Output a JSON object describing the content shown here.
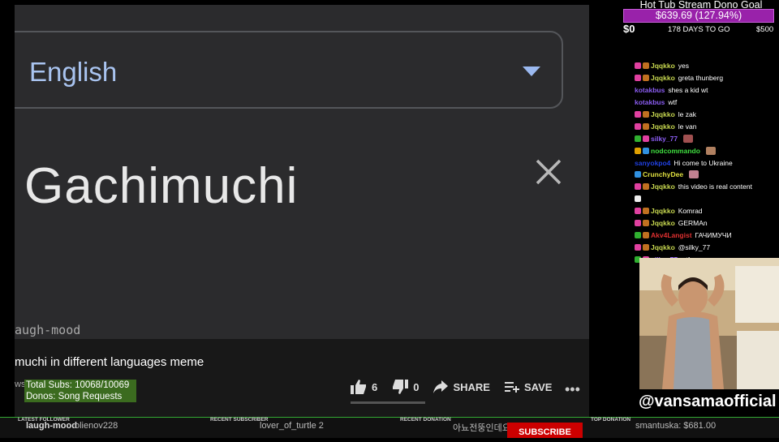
{
  "video": {
    "language_value": "English",
    "word": "Gachimuchi",
    "watermark": "augh-mood",
    "title": "muchi in different languages meme",
    "channel_fragment": "ws"
  },
  "actions": {
    "likes": "6",
    "dislikes": "0",
    "share": "SHARE",
    "save": "SAVE",
    "more": "•••"
  },
  "overlay": {
    "subs_line": "Total Subs:  10068/10069",
    "donos_line": "Donos: Song Requests"
  },
  "goal": {
    "title": "Hot Tub Stream Dono Goal",
    "amount": "$639.69 (127.94%)",
    "min": "$0",
    "days": "178 DAYS TO GO",
    "max": "$500",
    "progress": 1.0,
    "color": "#9922aa"
  },
  "chat": [
    {
      "badges": [
        "#e040a0",
        "#c07020"
      ],
      "user": "Jqqkko",
      "color": "#c8d850",
      "text": "yes"
    },
    {
      "badges": [
        "#e040a0",
        "#c07020"
      ],
      "user": "Jqqkko",
      "color": "#c8d850",
      "text": "greta thunberg"
    },
    {
      "badges": [],
      "user": "kotakbus",
      "color": "#8a5cf0",
      "text": "shes a kid wt"
    },
    {
      "badges": [],
      "user": "kotakbus",
      "color": "#8a5cf0",
      "text": "wtf"
    },
    {
      "badges": [
        "#e040a0",
        "#c07020"
      ],
      "user": "Jqqkko",
      "color": "#c8d850",
      "text": "le zak"
    },
    {
      "badges": [
        "#e040a0",
        "#c07020"
      ],
      "user": "Jqqkko",
      "color": "#c8d850",
      "text": "le van"
    },
    {
      "badges": [
        "#30b030",
        "#e040a0"
      ],
      "user": "silky_77",
      "color": "#8a5cf0",
      "text": "",
      "emote": "#a05050"
    },
    {
      "badges": [
        "#e0a000",
        "#3090e0"
      ],
      "user": "nodcommando",
      "color": "#40e040",
      "text": "",
      "emote": "#b08060"
    },
    {
      "badges": [],
      "user": "sanyokpo4",
      "color": "#2040e0",
      "text": "Hi come to Ukraine"
    },
    {
      "badges": [
        "#3090e0"
      ],
      "user": "CrunchyDee",
      "color": "#e0e040",
      "text": "",
      "emote": "#c08090"
    },
    {
      "badges": [
        "#e040a0",
        "#c07020"
      ],
      "user": "Jqqkko",
      "color": "#c8d850",
      "text": "this video is real content"
    },
    {
      "badges": [
        "#eeeeee"
      ],
      "user": "",
      "color": "#ffffff",
      "text": ""
    },
    {
      "badges": [
        "#e040a0",
        "#c07020"
      ],
      "user": "Jqqkko",
      "color": "#c8d850",
      "text": "Komrad"
    },
    {
      "badges": [
        "#e040a0",
        "#c07020"
      ],
      "user": "Jqqkko",
      "color": "#c8d850",
      "text": "GERMAn"
    },
    {
      "badges": [
        "#30b030",
        "#c07020"
      ],
      "user": "Akv4Langist",
      "color": "#e03030",
      "text": "ГАЧИМУЧИ"
    },
    {
      "badges": [
        "#e040a0",
        "#c07020"
      ],
      "user": "Jqqkko",
      "color": "#c8d850",
      "text": "@silky_77"
    },
    {
      "badges": [
        "#30b030",
        "#e040a0"
      ],
      "user": "silky_77",
      "color": "#8a5cf0",
      "text": "wtf"
    }
  ],
  "webcam": {
    "handle": "@vansamaofficial"
  },
  "ticker": {
    "latest_follower_label": "LATEST FOLLOWER",
    "latest_follower": "laugh-mood",
    "latest_follower_value": "olienov228",
    "recent_subscriber_label": "RECENT SUBSCRIBER",
    "recent_subscriber": "lover_of_turtle 2",
    "recent_donation_label": "RECENT DONATION",
    "recent_donation": "아뇨전뚱인데요 $5.00",
    "subscribe": "SUBSCRIBE",
    "top_donation_label": "TOP DONATION",
    "top_donation": "smantuska: $681.00"
  }
}
